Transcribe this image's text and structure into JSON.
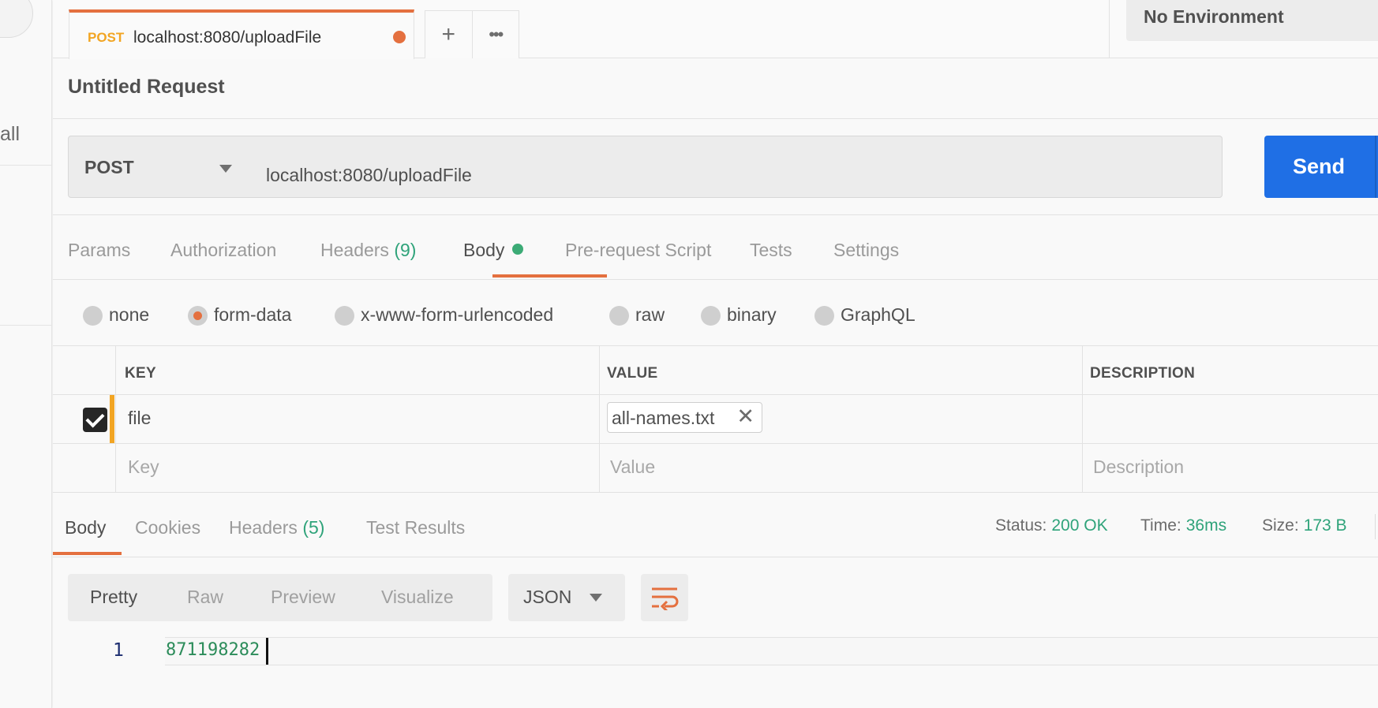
{
  "sidebar": {
    "partial_label": "all"
  },
  "tab": {
    "method": "POST",
    "url": "localhost:8080/uploadFile"
  },
  "tab_actions": {
    "add_icon": "plus-icon",
    "more_icon": "ellipsis-icon",
    "add_glyph": "+",
    "more_glyph": "•••"
  },
  "environment": {
    "selected": "No Environment"
  },
  "request": {
    "name": "Untitled Request",
    "method": "POST",
    "url": "localhost:8080/uploadFile",
    "send_label": "Send"
  },
  "request_tabs": [
    {
      "label": "Params"
    },
    {
      "label": "Authorization"
    },
    {
      "label": "Headers",
      "count": "(9)"
    },
    {
      "label": "Body",
      "active": true,
      "has_indicator": true
    },
    {
      "label": "Pre-request Script"
    },
    {
      "label": "Tests"
    },
    {
      "label": "Settings"
    }
  ],
  "body_types": [
    {
      "label": "none"
    },
    {
      "label": "form-data",
      "selected": true
    },
    {
      "label": "x-www-form-urlencoded"
    },
    {
      "label": "raw"
    },
    {
      "label": "binary"
    },
    {
      "label": "GraphQL"
    }
  ],
  "form_table": {
    "headers": [
      "KEY",
      "VALUE",
      "DESCRIPTION"
    ],
    "rows": [
      {
        "checked": true,
        "key": "file",
        "value_file": "all-names.txt",
        "description": ""
      }
    ],
    "placeholders": {
      "key": "Key",
      "value": "Value",
      "description": "Description"
    }
  },
  "response_tabs": [
    {
      "label": "Body",
      "active": true
    },
    {
      "label": "Cookies"
    },
    {
      "label": "Headers",
      "count": "(5)"
    },
    {
      "label": "Test Results"
    }
  ],
  "response_status": {
    "status_label": "Status:",
    "status_value": "200 OK",
    "time_label": "Time:",
    "time_value": "36ms",
    "size_label": "Size:",
    "size_value": "173 B"
  },
  "view_modes": [
    "Pretty",
    "Raw",
    "Preview",
    "Visualize"
  ],
  "active_view_mode": "Pretty",
  "language": "JSON",
  "response_body": {
    "line_number": "1",
    "content": "871198282"
  },
  "colors": {
    "accent": "#e4703f",
    "send": "#1f6fe5",
    "success": "#2fa37a",
    "method_post": "#f2a523"
  }
}
